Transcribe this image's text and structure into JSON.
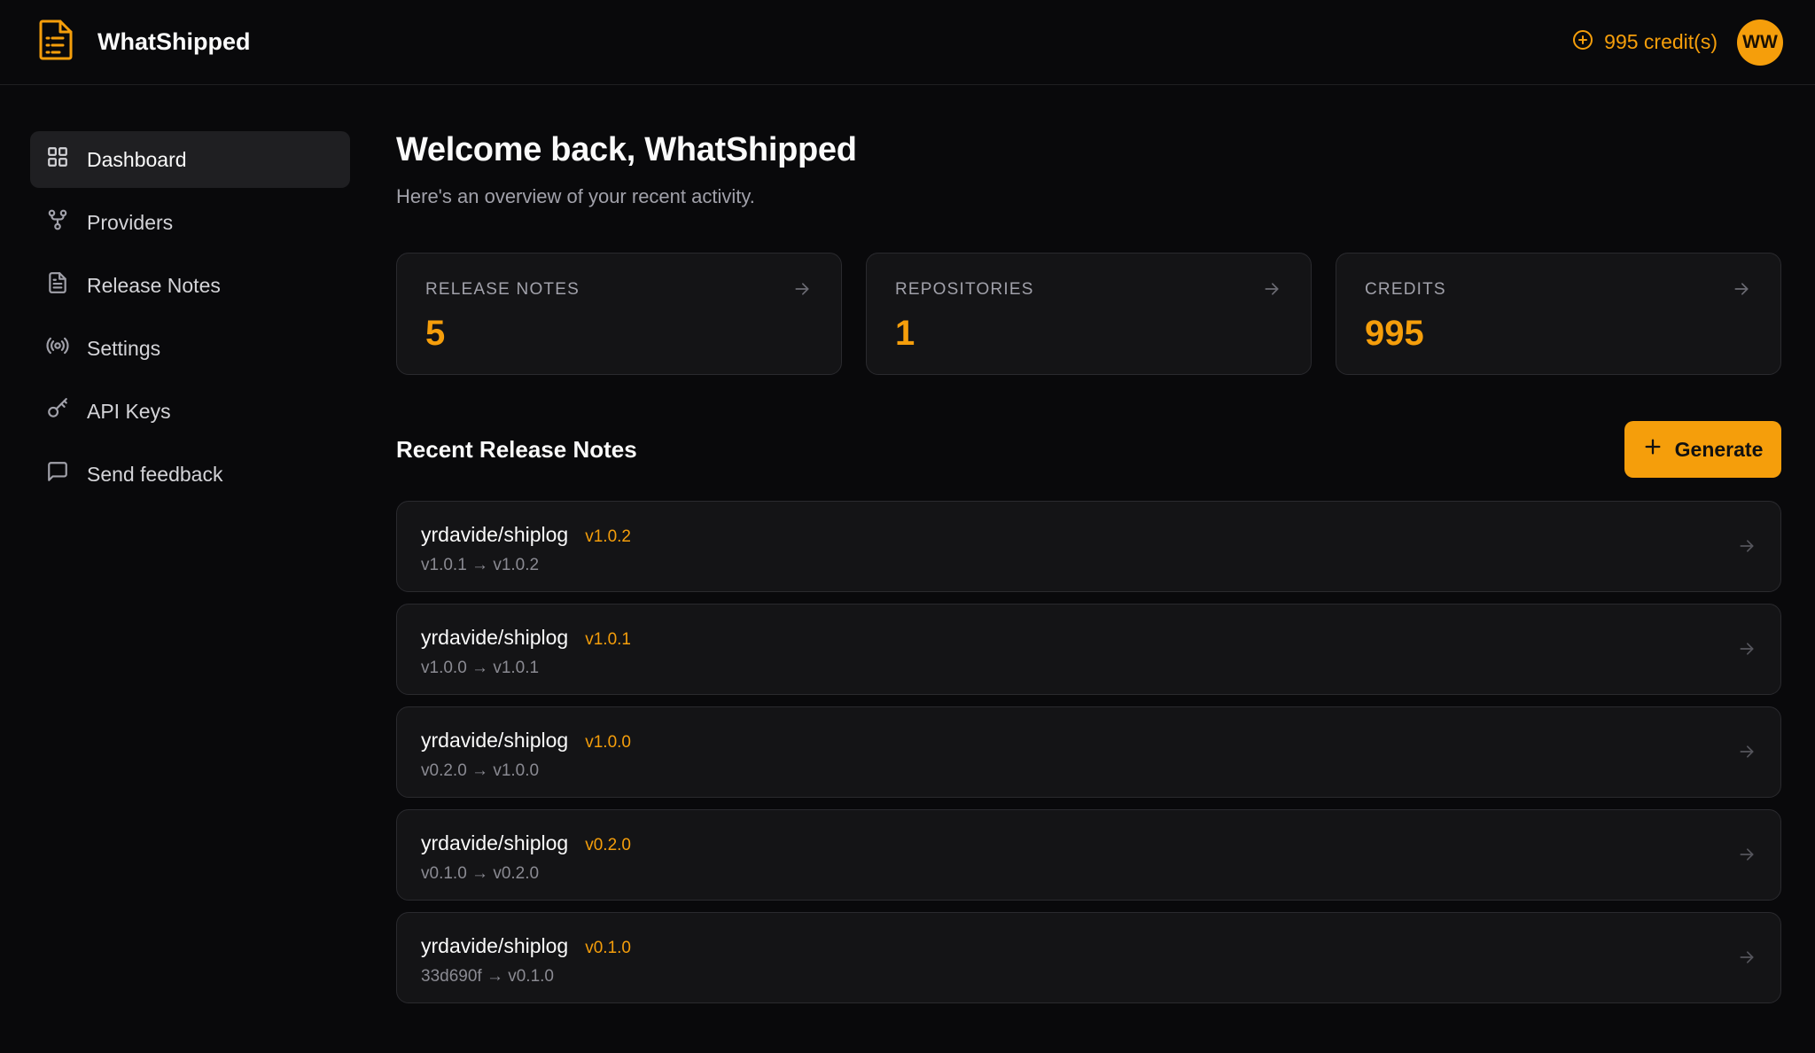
{
  "app": {
    "name": "WhatShipped",
    "credits_label": "995 credit(s)",
    "avatar_initials": "WW",
    "accent_color": "#f59e0b"
  },
  "sidebar": {
    "items": [
      {
        "label": "Dashboard",
        "icon": "grid-icon",
        "active": true
      },
      {
        "label": "Providers",
        "icon": "git-fork-icon",
        "active": false
      },
      {
        "label": "Release Notes",
        "icon": "file-text-icon",
        "active": false
      },
      {
        "label": "Settings",
        "icon": "radio-icon",
        "active": false
      },
      {
        "label": "API Keys",
        "icon": "key-icon",
        "active": false
      },
      {
        "label": "Send feedback",
        "icon": "message-square-icon",
        "active": false
      }
    ]
  },
  "main": {
    "title": "Welcome back, WhatShipped",
    "subtitle": "Here's an overview of your recent activity.",
    "stats": [
      {
        "label": "RELEASE NOTES",
        "value": "5"
      },
      {
        "label": "REPOSITORIES",
        "value": "1"
      },
      {
        "label": "CREDITS",
        "value": "995"
      }
    ],
    "recent_title": "Recent Release Notes",
    "generate_label": "Generate",
    "notes": [
      {
        "repo": "yrdavide/shiplog",
        "version": "v1.0.2",
        "range": "v1.0.1 → v1.0.2"
      },
      {
        "repo": "yrdavide/shiplog",
        "version": "v1.0.1",
        "range": "v1.0.0 → v1.0.1"
      },
      {
        "repo": "yrdavide/shiplog",
        "version": "v1.0.0",
        "range": "v0.2.0 → v1.0.0"
      },
      {
        "repo": "yrdavide/shiplog",
        "version": "v0.2.0",
        "range": "v0.1.0 → v0.2.0"
      },
      {
        "repo": "yrdavide/shiplog",
        "version": "v0.1.0",
        "range": "33d690f → v0.1.0"
      }
    ]
  }
}
